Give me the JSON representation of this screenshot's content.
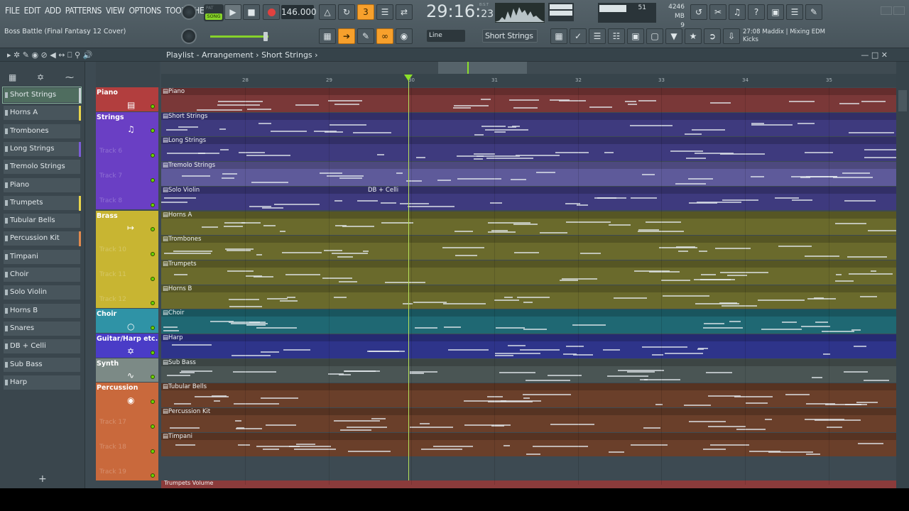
{
  "menu": [
    "FILE",
    "EDIT",
    "ADD",
    "PATTERNS",
    "VIEW",
    "OPTIONS",
    "TOOLS",
    "HELP"
  ],
  "project_title": "Boss Battle (Final Fantasy 12 Cover)",
  "song_mode": {
    "pat": "PAT",
    "song": "SONG"
  },
  "tempo": "146.000",
  "time": {
    "main": "29:16",
    "sub": "23",
    "bst": "B:S:T"
  },
  "cpu": {
    "value": "51"
  },
  "memory": {
    "mb": "4246 MB",
    "voices": "9"
  },
  "snap": "Line",
  "channel_selector": "Short Strings",
  "hint": {
    "line1": "27:08  Maddix | Mixing EDM",
    "line2": "Kicks"
  },
  "playlist_title": "Playlist - Arrangement",
  "playlist_crumb": "Short Strings",
  "ruler": [
    "28",
    "29",
    "30",
    "31",
    "32",
    "33",
    "34",
    "35"
  ],
  "browser": [
    {
      "label": "Short Strings",
      "color": "#c8d0d4",
      "selected": true
    },
    {
      "label": "Horns A",
      "color": "#e9d44b"
    },
    {
      "label": "Trombones",
      "color": ""
    },
    {
      "label": "Long Strings",
      "color": "#7b5cd6"
    },
    {
      "label": "Tremolo Strings",
      "color": ""
    },
    {
      "label": "Piano",
      "color": ""
    },
    {
      "label": "Trumpets",
      "color": "#e9d44b"
    },
    {
      "label": "Tubular Bells",
      "color": ""
    },
    {
      "label": "Percussion Kit",
      "color": "#e08a4e"
    },
    {
      "label": "Timpani",
      "color": ""
    },
    {
      "label": "Choir",
      "color": ""
    },
    {
      "label": "Solo Violin",
      "color": ""
    },
    {
      "label": "Horns B",
      "color": ""
    },
    {
      "label": "Snares",
      "color": ""
    },
    {
      "label": "DB + Celli",
      "color": ""
    },
    {
      "label": "Sub Bass",
      "color": ""
    },
    {
      "label": "Harp",
      "color": ""
    }
  ],
  "groups": [
    {
      "name": "Piano",
      "color": "#b23e3e",
      "icon": "piano-icon"
    },
    {
      "name": "Strings",
      "color": "#6a3fc4",
      "icon": "violin-icon"
    },
    {
      "name": "Brass",
      "color": "#c8b532",
      "icon": "trumpet-icon"
    },
    {
      "name": "Choir",
      "color": "#2f93a6",
      "icon": "lips-icon"
    },
    {
      "name": "Guitar/Harp etc.",
      "color": "#4a3cc7",
      "icon": "harp-icon"
    },
    {
      "name": "Synth",
      "color": "#7c8a86",
      "icon": "wave-icon"
    },
    {
      "name": "Percussion",
      "color": "#c9693c",
      "icon": "drum-icon"
    }
  ],
  "track_labels": [
    "Track 6",
    "Track 7",
    "Track 8",
    "Track 10",
    "Track 11",
    "Track 12",
    "Track 17",
    "Track 18",
    "Track 19"
  ],
  "clips": [
    {
      "label": "Piano",
      "color": "#7a3838"
    },
    {
      "label": "Short Strings",
      "color": "#3e3a7e"
    },
    {
      "label": "Long Strings",
      "color": "#3e3a7e"
    },
    {
      "label": "Tremolo Strings",
      "color": "#5e5a9a"
    },
    {
      "label": "Solo Violin",
      "color": "#3e3a7e",
      "extra": "DB + Celli"
    },
    {
      "label": "Horns A",
      "color": "#6a6a2c"
    },
    {
      "label": "Trombones",
      "color": "#6a6a2c"
    },
    {
      "label": "Trumpets",
      "color": "#6a6a2c"
    },
    {
      "label": "Horns B",
      "color": "#6a6a2c"
    },
    {
      "label": "Choir",
      "color": "#1f6873"
    },
    {
      "label": "Harp",
      "color": "#2e348a"
    },
    {
      "label": "Sub Bass",
      "color": "#4a5554"
    },
    {
      "label": "Tubular Bells",
      "color": "#6a3f2a"
    },
    {
      "label": "Percussion Kit",
      "color": "#6a3f2a"
    },
    {
      "label": "Timpani",
      "color": "#6a3f2a"
    }
  ],
  "bottom_clip": "Trumpets Volume"
}
